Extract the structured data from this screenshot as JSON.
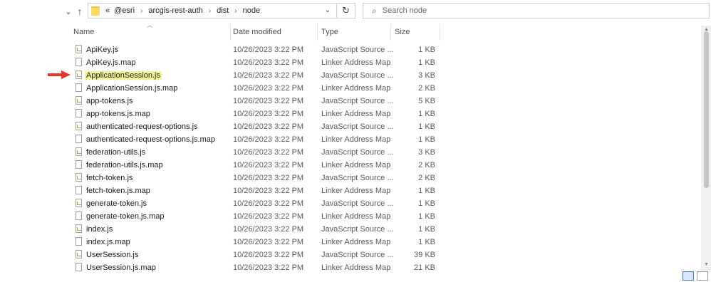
{
  "nav": {
    "expand_icon": "chevron-down-icon",
    "up_icon": "arrow-up-icon"
  },
  "address": {
    "overflow": "«",
    "crumbs": [
      "@esri",
      "arcgis-rest-auth",
      "dist",
      "node"
    ],
    "dropdown_icon": "chevron-down-icon",
    "refresh_icon": "refresh-icon"
  },
  "search": {
    "placeholder": "Search node",
    "icon": "search-icon"
  },
  "columns": {
    "name": "Name",
    "date": "Date modified",
    "type": "Type",
    "size": "Size"
  },
  "files": [
    {
      "name": "ApiKey.js",
      "date": "10/26/2023 3:22 PM",
      "type": "JavaScript Source ...",
      "size": "1 KB",
      "kind": "js"
    },
    {
      "name": "ApiKey.js.map",
      "date": "10/26/2023 3:22 PM",
      "type": "Linker Address Map",
      "size": "1 KB",
      "kind": "map"
    },
    {
      "name": "ApplicationSession.js",
      "date": "10/26/2023 3:22 PM",
      "type": "JavaScript Source ...",
      "size": "3 KB",
      "kind": "js",
      "highlighted": true
    },
    {
      "name": "ApplicationSession.js.map",
      "date": "10/26/2023 3:22 PM",
      "type": "Linker Address Map",
      "size": "2 KB",
      "kind": "map"
    },
    {
      "name": "app-tokens.js",
      "date": "10/26/2023 3:22 PM",
      "type": "JavaScript Source ...",
      "size": "5 KB",
      "kind": "js"
    },
    {
      "name": "app-tokens.js.map",
      "date": "10/26/2023 3:22 PM",
      "type": "Linker Address Map",
      "size": "1 KB",
      "kind": "map"
    },
    {
      "name": "authenticated-request-options.js",
      "date": "10/26/2023 3:22 PM",
      "type": "JavaScript Source ...",
      "size": "1 KB",
      "kind": "js"
    },
    {
      "name": "authenticated-request-options.js.map",
      "date": "10/26/2023 3:22 PM",
      "type": "Linker Address Map",
      "size": "1 KB",
      "kind": "map"
    },
    {
      "name": "federation-utils.js",
      "date": "10/26/2023 3:22 PM",
      "type": "JavaScript Source ...",
      "size": "3 KB",
      "kind": "js"
    },
    {
      "name": "federation-utils.js.map",
      "date": "10/26/2023 3:22 PM",
      "type": "Linker Address Map",
      "size": "2 KB",
      "kind": "map"
    },
    {
      "name": "fetch-token.js",
      "date": "10/26/2023 3:22 PM",
      "type": "JavaScript Source ...",
      "size": "2 KB",
      "kind": "js"
    },
    {
      "name": "fetch-token.js.map",
      "date": "10/26/2023 3:22 PM",
      "type": "Linker Address Map",
      "size": "1 KB",
      "kind": "map"
    },
    {
      "name": "generate-token.js",
      "date": "10/26/2023 3:22 PM",
      "type": "JavaScript Source ...",
      "size": "1 KB",
      "kind": "js"
    },
    {
      "name": "generate-token.js.map",
      "date": "10/26/2023 3:22 PM",
      "type": "Linker Address Map",
      "size": "1 KB",
      "kind": "map"
    },
    {
      "name": "index.js",
      "date": "10/26/2023 3:22 PM",
      "type": "JavaScript Source ...",
      "size": "1 KB",
      "kind": "js"
    },
    {
      "name": "index.js.map",
      "date": "10/26/2023 3:22 PM",
      "type": "Linker Address Map",
      "size": "1 KB",
      "kind": "map"
    },
    {
      "name": "UserSession.js",
      "date": "10/26/2023 3:22 PM",
      "type": "JavaScript Source ...",
      "size": "39 KB",
      "kind": "js"
    },
    {
      "name": "UserSession.js.map",
      "date": "10/26/2023 3:22 PM",
      "type": "Linker Address Map",
      "size": "21 KB",
      "kind": "map"
    }
  ],
  "colors": {
    "highlight": "#f3f59a",
    "annotation_arrow": "#e8342a",
    "folder": "#ffd966"
  }
}
